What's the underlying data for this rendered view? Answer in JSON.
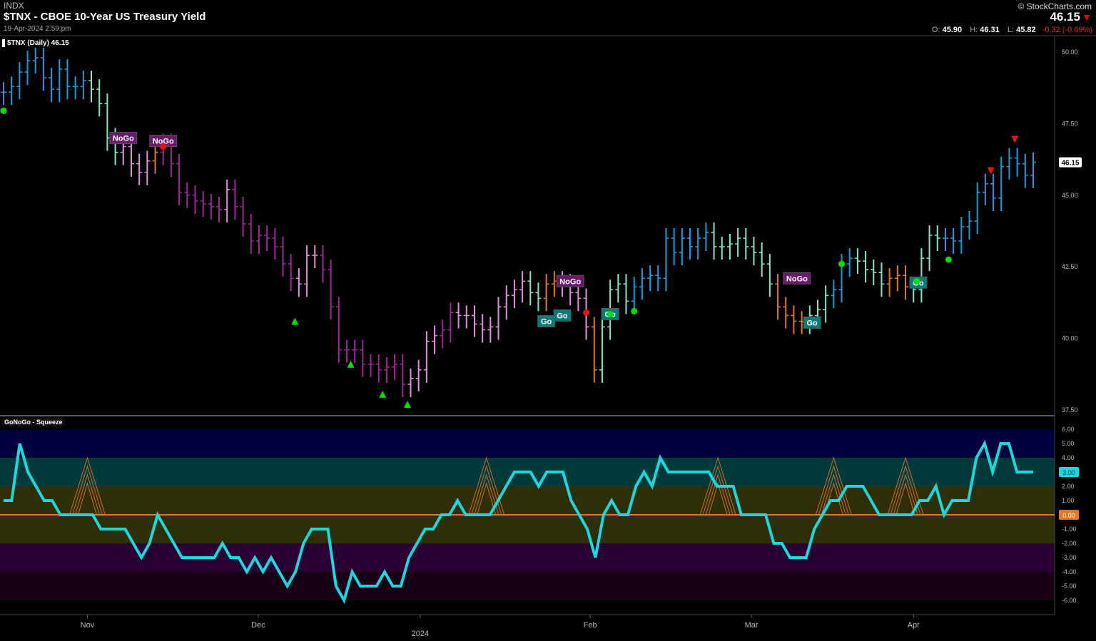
{
  "header": {
    "exchange": "INDX",
    "title": "$TNX - CBOE 10-Year US Treasury Yield",
    "date": "19-Apr-2024 2:59:pm",
    "copyright": "© StockCharts.com",
    "last": "46.15",
    "open_label": "O:",
    "open": "45.90",
    "high_label": "H:",
    "high": "46.31",
    "low_label": "L:",
    "low": "45.82",
    "change": "-0.32 (-0.69%)"
  },
  "colors": {
    "B": "#1e9be0",
    "G": "#86e8c4",
    "P": "#e58fe0",
    "M": "#a0249c",
    "O": "#e07a28",
    "osc": "#1ed6dc",
    "up": "#00e000",
    "down": "#ee1111"
  },
  "chart_data": [
    {
      "type": "ohlc",
      "title": "$TNX (Daily) 46.15",
      "ylim": [
        37.5,
        50.5
      ],
      "yticks": [
        "50.00",
        "47.50",
        "45.00",
        "42.50",
        "40.00",
        "37.50"
      ],
      "ytick_values": [
        50,
        47.5,
        45,
        42.5,
        40,
        37.5
      ],
      "last_label": "46.15",
      "closes": [
        48.6,
        48.8,
        49.3,
        49.7,
        49.8,
        49.1,
        48.7,
        49.4,
        48.8,
        48.8,
        49.0,
        48.7,
        48.2,
        47.0,
        46.5,
        46.7,
        46.1,
        45.8,
        46.2,
        46.5,
        46.8,
        46.1,
        45.1,
        45.0,
        44.8,
        44.7,
        44.6,
        44.5,
        45.2,
        44.6,
        44.0,
        43.4,
        43.6,
        43.5,
        43.2,
        42.6,
        42.1,
        41.9,
        42.9,
        42.9,
        42.4,
        41.1,
        39.6,
        39.6,
        39.6,
        39.1,
        39.1,
        38.9,
        39.0,
        39.1,
        38.4,
        38.6,
        38.9,
        39.9,
        40.1,
        40.3,
        40.9,
        40.8,
        40.8,
        40.5,
        40.3,
        40.4,
        41.1,
        41.5,
        41.7,
        42.0,
        41.6,
        41.4,
        41.9,
        42.0,
        41.9,
        41.6,
        41.4,
        40.4,
        38.9,
        40.4,
        41.7,
        41.9,
        41.3,
        41.8,
        42.1,
        42.2,
        42.1,
        43.5,
        43.0,
        43.5,
        43.2,
        43.5,
        43.7,
        43.2,
        43.2,
        43.3,
        43.5,
        43.2,
        43.0,
        42.6,
        41.9,
        41.1,
        40.8,
        40.6,
        40.6,
        40.8,
        41.0,
        41.5,
        41.7,
        42.6,
        42.8,
        42.7,
        42.4,
        42.3,
        41.9,
        42.1,
        42.2,
        41.8,
        41.7,
        42.8,
        43.6,
        43.5,
        43.5,
        43.4,
        43.9,
        44.1,
        45.1,
        45.4,
        44.9,
        46.0,
        46.3,
        46.1,
        45.7,
        46.15
      ],
      "colors": "BBBBBBBBBBBGGGGPPPPOMMMMMMMMPMMMMMMMMPPPMMMMMMMMMMMPPPPMMPPPPPPPPPGGOOPPPPOGGGGBBBBBBBBBBGGGGGGGGOOOOGGGBBBGGGGOOOGGGGBBBBBBBBBBB",
      "labels": [
        {
          "text": "NoGo",
          "bar": 15,
          "value": 47.0
        },
        {
          "text": "NoGo",
          "bar": 20,
          "value": 46.9
        },
        {
          "text": "NoGo",
          "bar": 71,
          "value": 42.0
        },
        {
          "text": "NoGo",
          "bar": 99.4,
          "value": 42.1
        },
        {
          "text": "Go",
          "bar": 68,
          "value": 40.6
        },
        {
          "text": "Go",
          "bar": 70,
          "value": 40.8
        },
        {
          "text": "Go",
          "bar": 76,
          "value": 40.85
        },
        {
          "text": "Go",
          "bar": 101.3,
          "value": 40.55
        },
        {
          "text": "Go",
          "bar": 114.6,
          "value": 41.95
        }
      ],
      "up_triangles": [
        36.5,
        43.5,
        47.5,
        50.6
      ],
      "up_triangle_values": [
        40.6,
        39.1,
        38.05,
        37.7
      ],
      "down_triangles": [
        123.7,
        126.7
      ],
      "down_triangle_values": [
        45.85,
        46.95
      ],
      "up_dots": [
        [
          0,
          47.95
        ],
        [
          76,
          40.85
        ],
        [
          79,
          40.95
        ],
        [
          105,
          42.6
        ],
        [
          114.4,
          42.0
        ],
        [
          118.4,
          42.75
        ]
      ],
      "down_dots": [
        [
          20,
          46.7
        ],
        [
          73,
          40.9
        ]
      ]
    },
    {
      "type": "line",
      "title": "GoNoGo - Squeeze",
      "ylim": [
        -6,
        6
      ],
      "yticks": [
        "6.00",
        "5.00",
        "4.00",
        "3.00",
        "2.00",
        "1.00",
        "0.00",
        "-1.00",
        "-2.00",
        "-3.00",
        "-4.00",
        "-5.00",
        "-6.00"
      ],
      "last_label": "3.00",
      "zero_label": "0.00",
      "values": [
        1,
        1,
        5,
        3,
        2,
        1,
        1,
        0,
        0,
        0,
        0,
        0,
        -1,
        -1,
        -1,
        -1,
        -2,
        -3,
        -2,
        0,
        -1,
        -2,
        -3,
        -3,
        -3,
        -3,
        -3,
        -2,
        -3,
        -3,
        -4,
        -3,
        -4,
        -3,
        -4,
        -5,
        -4,
        -2,
        -1,
        -1,
        -1,
        -5,
        -6,
        -4,
        -5,
        -5,
        -5,
        -4,
        -5,
        -5,
        -3,
        -2,
        -1,
        -1,
        0,
        0,
        1,
        0,
        0,
        0,
        0,
        1,
        2,
        3,
        3,
        3,
        2,
        3,
        3,
        3,
        1,
        0,
        -1,
        -3,
        0,
        1,
        0,
        0,
        2,
        3,
        2,
        4,
        3,
        3,
        3,
        3,
        3,
        3,
        2,
        2,
        2,
        0,
        0,
        0,
        0,
        -2,
        -2,
        -3,
        -3,
        -3,
        -1,
        0,
        1,
        1,
        2,
        2,
        2,
        1,
        0,
        0,
        0,
        0,
        0,
        1,
        1,
        2,
        0,
        1,
        1,
        1,
        4,
        5,
        3,
        5,
        5,
        3,
        3,
        3
      ],
      "squeeze_bars": [
        10.5,
        60.5,
        89.5,
        104,
        113
      ]
    }
  ],
  "xaxis": {
    "labels": [
      {
        "text": "Nov",
        "bar": 10.5
      },
      {
        "text": "Dec",
        "bar": 31.9
      },
      {
        "text": "2024",
        "bar": 52.2
      },
      {
        "text": "Feb",
        "bar": 73.5
      },
      {
        "text": "Mar",
        "bar": 93.7
      },
      {
        "text": "Apr",
        "bar": 114
      }
    ]
  }
}
